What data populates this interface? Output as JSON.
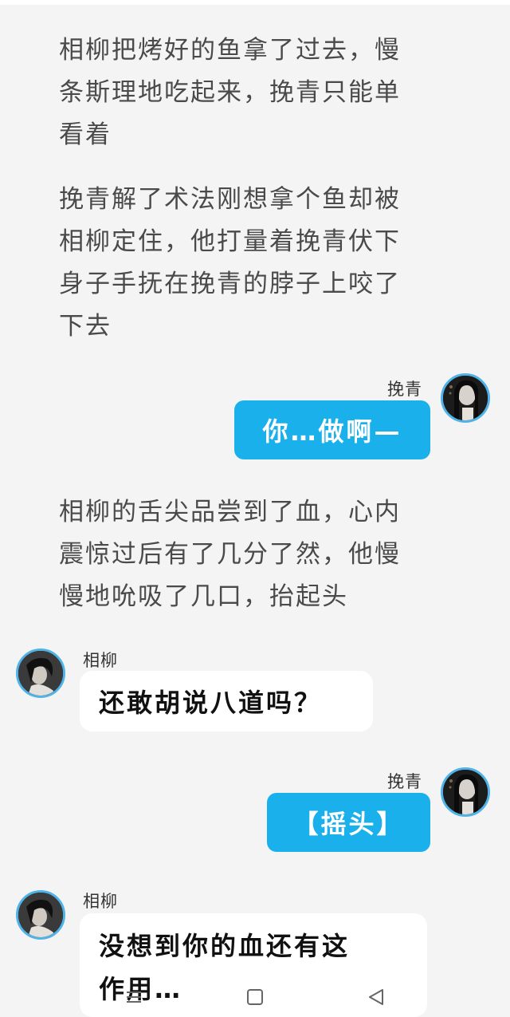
{
  "narration": [
    {
      "lines": [
        "相柳把烤好的鱼拿了过去，慢",
        "条斯理地吃起来，挽青只能单",
        "看着"
      ]
    },
    {
      "lines": [
        "挽青解了术法刚想拿个鱼却被",
        "相柳定住，他打量着挽青伏下",
        "身子手抚在挽青的脖子上咬了",
        "下去"
      ]
    },
    {
      "lines": [
        "相柳的舌尖品尝到了血，心内",
        "震惊过后有了几分了然，他慢",
        "慢地吮吸了几口，抬起头"
      ]
    }
  ],
  "messages": [
    {
      "speaker": "挽青",
      "side": "right",
      "text": "你…做啊—"
    },
    {
      "speaker": "相柳",
      "side": "left",
      "text": "还敢胡说八道吗？"
    },
    {
      "speaker": "挽青",
      "side": "right",
      "text": "【摇头】"
    },
    {
      "speaker": "相柳",
      "side": "left",
      "lines": [
        "没想到你的血还有这",
        "作用…"
      ]
    }
  ],
  "navbar": {
    "menu_icon": "menu-icon",
    "home_icon": "square-home-icon",
    "back_icon": "triangle-back-icon"
  },
  "colors": {
    "background": "#f4f4f5",
    "bubble_blue": "#19b0ec",
    "avatar_ring": "#4fb3e8",
    "narration_text": "#4a4a4a"
  }
}
